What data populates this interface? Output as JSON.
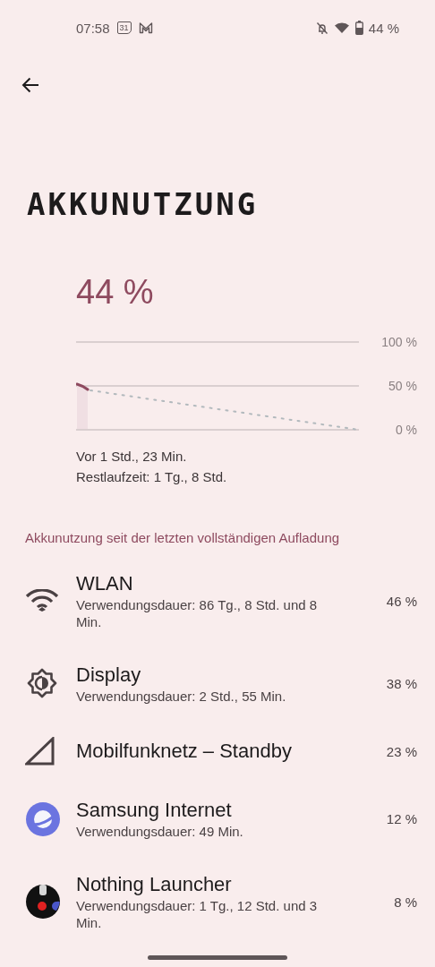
{
  "status_bar": {
    "time": "07:58",
    "calendar_badge": "31",
    "battery": "44 %"
  },
  "title": "AKKUNUTZUNG",
  "battery_level": "44 %",
  "chart": {
    "axis_labels": [
      "100 %",
      "50 %",
      "0 %"
    ]
  },
  "last_charged": "Vor 1 Std., 23 Min.",
  "remaining": "Restlaufzeit: 1 Tg., 8 Std.",
  "section_header": "Akkunutzung seit der letzten vollständigen Aufladung",
  "usage": [
    {
      "kind": "wifi",
      "name": "WLAN",
      "detail": "Verwendungsdauer: 86 Tg., 8 Std. und 8 Min.",
      "percent": "46 %"
    },
    {
      "kind": "display",
      "name": "Display",
      "detail": "Verwendungsdauer: 2 Std., 55 Min.",
      "percent": "38 %"
    },
    {
      "kind": "cell",
      "name": "Mobilfunknetz – Standby",
      "percent": "23 %"
    },
    {
      "kind": "planet",
      "name": "Samsung Internet",
      "detail": "Verwendungsdauer: 49 Min.",
      "percent": "12 %"
    },
    {
      "kind": "launcher",
      "name": "Nothing Launcher",
      "detail": "Verwendungsdauer: 1 Tg., 12 Std. und 3 Min.",
      "percent": "8 %"
    }
  ]
}
